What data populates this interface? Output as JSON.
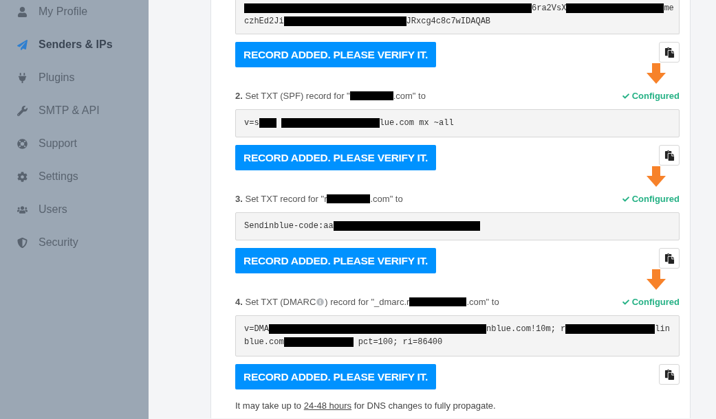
{
  "sidebar": {
    "items": [
      {
        "label": "My Profile",
        "selected": false
      },
      {
        "label": "Senders & IPs",
        "selected": true
      },
      {
        "label": "Plugins",
        "selected": false
      },
      {
        "label": "SMTP & API",
        "selected": false
      },
      {
        "label": "Support",
        "selected": false
      },
      {
        "label": "Settings",
        "selected": false
      },
      {
        "label": "Users",
        "selected": false
      },
      {
        "label": "Security",
        "selected": false
      }
    ]
  },
  "steps": [
    {
      "value_lines": [
        [
          {
            "kind": "redacted"
          },
          {
            "kind": "text",
            "text": "6ra2VsX"
          },
          {
            "kind": "redacted"
          },
          {
            "kind": "text",
            "text": "me"
          }
        ],
        [
          {
            "kind": "text",
            "text": "czhEd2Ji"
          },
          {
            "kind": "redacted"
          },
          {
            "kind": "text",
            "text": "JRxcg4c8c7wIDAQAB"
          }
        ]
      ],
      "button": "RECORD ADDED. PLEASE VERIFY IT."
    },
    {
      "heading": [
        {
          "kind": "text",
          "text": "**2.** Set TXT (SPF) record for \""
        },
        {
          "kind": "redacted"
        },
        {
          "kind": "text",
          "text": ".com\" to"
        }
      ],
      "status": "Configured",
      "marked": true,
      "value_lines": [
        [
          {
            "kind": "text",
            "text": "v=s"
          },
          {
            "kind": "redacted"
          },
          {
            "kind": "redacted"
          },
          {
            "kind": "text",
            "text": "lue.com mx ~all"
          }
        ]
      ],
      "button": "RECORD ADDED. PLEASE VERIFY IT."
    },
    {
      "heading": [
        {
          "kind": "text",
          "text": "**3.** Set TXT record for \"r"
        },
        {
          "kind": "redacted"
        },
        {
          "kind": "text",
          "text": ".com\" to"
        }
      ],
      "status": "Configured",
      "marked": true,
      "value_lines": [
        [
          {
            "kind": "text",
            "text": "Sendinblue-code:aa"
          },
          {
            "kind": "redacted"
          }
        ]
      ],
      "button": "RECORD ADDED. PLEASE VERIFY IT."
    },
    {
      "heading": [
        {
          "kind": "text",
          "text": "**4.** Set TXT (DMARC"
        },
        {
          "kind": "info"
        },
        {
          "kind": "text",
          "text": ") record for \"_dmarc.r"
        },
        {
          "kind": "redacted"
        },
        {
          "kind": "text",
          "text": ".com\" to"
        }
      ],
      "status": "Configured",
      "marked": true,
      "value_lines": [
        [
          {
            "kind": "text",
            "text": "v=DMA"
          },
          {
            "kind": "redacted"
          },
          {
            "kind": "text",
            "text": "nblue.com!10m; r"
          },
          {
            "kind": "redacted"
          },
          {
            "kind": "text",
            "text": "lin"
          }
        ],
        [
          {
            "kind": "text",
            "text": "blue.com"
          },
          {
            "kind": "redacted"
          },
          {
            "kind": "text",
            "text": " pct=100; ri=86400"
          }
        ]
      ],
      "button": "RECORD ADDED. PLEASE VERIFY IT."
    }
  ],
  "footer": {
    "before": "It may take up to ",
    "link": "24-48 hours",
    "after": " for DNS changes to fully propagate."
  }
}
